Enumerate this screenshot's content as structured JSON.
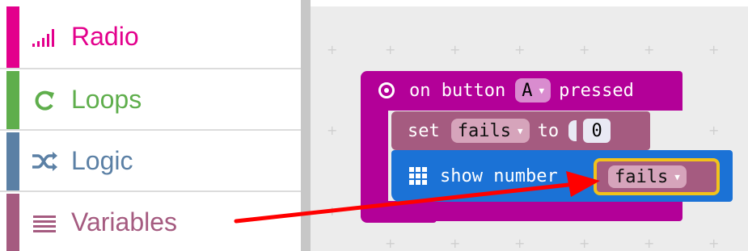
{
  "toolbox": {
    "categories": [
      {
        "label": "Radio",
        "icon": "signal-bars-icon",
        "color": "#e3008c"
      },
      {
        "label": "Loops",
        "icon": "loop-arrow-icon",
        "color": "#5fae4c"
      },
      {
        "label": "Logic",
        "icon": "shuffle-icon",
        "color": "#5b80a5"
      },
      {
        "label": "Variables",
        "icon": "list-lines-icon",
        "color": "#a55b80"
      }
    ]
  },
  "workspace": {
    "event_block": {
      "label_on": "on button",
      "button_value": "A",
      "label_pressed": "pressed",
      "color": "#b30098"
    },
    "set_block": {
      "label_set": "set",
      "variable": "fails",
      "label_to": "to",
      "value": "0",
      "color": "#a55b80"
    },
    "show_block": {
      "label": "show number",
      "variable": "fails",
      "color": "#1b72d6",
      "highlight_color": "#f2c21b"
    },
    "annotation": {
      "arrow_color": "#ff0000"
    }
  }
}
